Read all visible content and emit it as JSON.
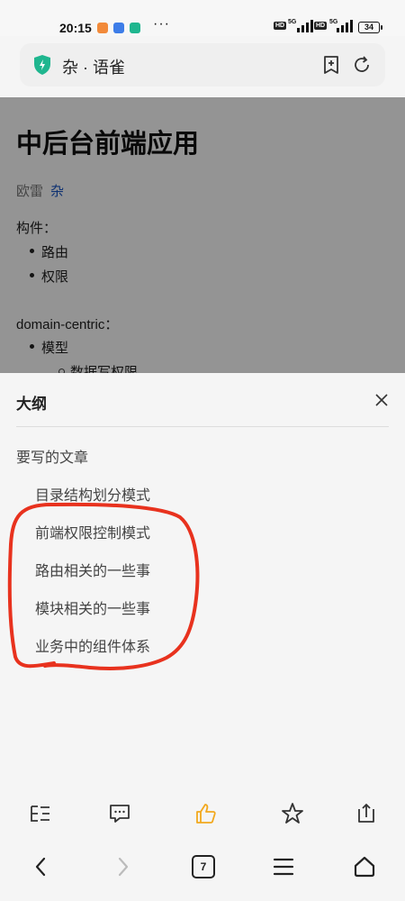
{
  "status_bar": {
    "time": "20:15",
    "battery": "34",
    "more": "···",
    "network": "5G",
    "hd": "HD"
  },
  "address_bar": {
    "title": "杂 · 语雀"
  },
  "document": {
    "title": "中后台前端应用",
    "author": "欧雷",
    "book": "杂",
    "components_label": "构件：",
    "components": [
      "路由",
      "权限"
    ],
    "domain_label": "domain-centric：",
    "domain_items": [
      "模型"
    ],
    "sub_items": [
      "数据写权限"
    ]
  },
  "outline": {
    "title": "大纲",
    "top_item": "要写的文章",
    "items": [
      "目录结构划分模式",
      "前端权限控制模式",
      "路由相关的一些事",
      "模块相关的一些事",
      "业务中的组件体系"
    ]
  },
  "colors": {
    "annotation": "#e8321e",
    "like": "#f2a81d",
    "link": "#1a56c4",
    "shield": "#1fb68f"
  },
  "toolbar_icons": [
    "outline-icon",
    "comment-icon",
    "like-icon",
    "star-icon",
    "share-icon"
  ],
  "nav_icons": [
    "back-icon",
    "forward-icon",
    "tabs-icon",
    "menu-icon",
    "home-icon"
  ],
  "tabs": {
    "count": "7"
  }
}
